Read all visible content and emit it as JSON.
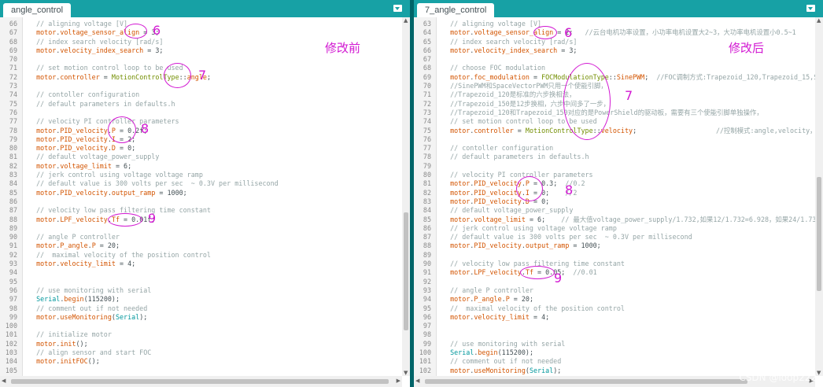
{
  "left": {
    "tab": "angle_control",
    "label": "修改前",
    "lines": [
      [
        66,
        [
          [
            "cm",
            "  // aligning voltage [V]"
          ]
        ]
      ],
      [
        67,
        [
          [
            "obj",
            "  motor"
          ],
          [
            "",
            "."
          ],
          [
            "obj",
            "voltage_sensor_align"
          ],
          [
            "",
            " = 3;"
          ]
        ]
      ],
      [
        68,
        [
          [
            "cm",
            "  // index search velocity [rad/s]"
          ]
        ]
      ],
      [
        69,
        [
          [
            "obj",
            "  motor"
          ],
          [
            "",
            "."
          ],
          [
            "obj",
            "velocity_index_search"
          ],
          [
            "",
            " = 3;"
          ]
        ]
      ],
      [
        70,
        []
      ],
      [
        71,
        [
          [
            "cm",
            "  // set motion control loop to be used"
          ]
        ]
      ],
      [
        72,
        [
          [
            "obj",
            "  motor"
          ],
          [
            "",
            "."
          ],
          [
            "obj",
            "controller"
          ],
          [
            "",
            " = "
          ],
          [
            "ty",
            "MotionControlType"
          ],
          [
            "",
            "::"
          ],
          [
            "obj",
            "angle"
          ],
          [
            "",
            ";"
          ]
        ]
      ],
      [
        73,
        []
      ],
      [
        74,
        [
          [
            "cm",
            "  // contoller configuration"
          ]
        ]
      ],
      [
        75,
        [
          [
            "cm",
            "  // default parameters in defaults.h"
          ]
        ]
      ],
      [
        76,
        []
      ],
      [
        77,
        [
          [
            "cm",
            "  // velocity PI controller parameters"
          ]
        ]
      ],
      [
        78,
        [
          [
            "obj",
            "  motor"
          ],
          [
            "",
            "."
          ],
          [
            "obj",
            "PID_velocity"
          ],
          [
            "",
            "."
          ],
          [
            "obj",
            "P"
          ],
          [
            "",
            " = 0.2f;"
          ]
        ]
      ],
      [
        79,
        [
          [
            "obj",
            "  motor"
          ],
          [
            "",
            "."
          ],
          [
            "obj",
            "PID_velocity"
          ],
          [
            "",
            "."
          ],
          [
            "obj",
            "I"
          ],
          [
            "",
            " = 2;"
          ]
        ]
      ],
      [
        80,
        [
          [
            "obj",
            "  motor"
          ],
          [
            "",
            "."
          ],
          [
            "obj",
            "PID_velocity"
          ],
          [
            "",
            "."
          ],
          [
            "obj",
            "D"
          ],
          [
            "",
            " = 0;"
          ]
        ]
      ],
      [
        81,
        [
          [
            "cm",
            "  // default voltage_power_supply"
          ]
        ]
      ],
      [
        82,
        [
          [
            "obj",
            "  motor"
          ],
          [
            "",
            "."
          ],
          [
            "obj",
            "voltage_limit"
          ],
          [
            "",
            " = 6;"
          ]
        ]
      ],
      [
        83,
        [
          [
            "cm",
            "  // jerk control using voltage voltage ramp"
          ]
        ]
      ],
      [
        84,
        [
          [
            "cm",
            "  // default value is 300 volts per sec  ~ 0.3V per millisecond"
          ]
        ]
      ],
      [
        85,
        [
          [
            "obj",
            "  motor"
          ],
          [
            "",
            "."
          ],
          [
            "obj",
            "PID_velocity"
          ],
          [
            "",
            "."
          ],
          [
            "obj",
            "output_ramp"
          ],
          [
            "",
            " = 1000;"
          ]
        ]
      ],
      [
        86,
        []
      ],
      [
        87,
        [
          [
            "cm",
            "  // velocity low pass filtering time constant"
          ]
        ]
      ],
      [
        88,
        [
          [
            "obj",
            "  motor"
          ],
          [
            "",
            "."
          ],
          [
            "obj",
            "LPF_velocity"
          ],
          [
            "",
            "."
          ],
          [
            "obj",
            "Tf"
          ],
          [
            "",
            " = 0.01f;"
          ]
        ]
      ],
      [
        89,
        []
      ],
      [
        90,
        [
          [
            "cm",
            "  // angle P controller"
          ]
        ]
      ],
      [
        91,
        [
          [
            "obj",
            "  motor"
          ],
          [
            "",
            "."
          ],
          [
            "obj",
            "P_angle"
          ],
          [
            "",
            "."
          ],
          [
            "obj",
            "P"
          ],
          [
            "",
            " = 20;"
          ]
        ]
      ],
      [
        92,
        [
          [
            "cm",
            "  //  maximal velocity of the position control"
          ]
        ]
      ],
      [
        93,
        [
          [
            "obj",
            "  motor"
          ],
          [
            "",
            "."
          ],
          [
            "obj",
            "velocity_limit"
          ],
          [
            "",
            " = 4;"
          ]
        ]
      ],
      [
        94,
        []
      ],
      [
        95,
        []
      ],
      [
        96,
        [
          [
            "cm",
            "  // use monitoring with serial"
          ]
        ]
      ],
      [
        97,
        [
          [
            "kw",
            "  Serial"
          ],
          [
            "",
            "."
          ],
          [
            "obj",
            "begin"
          ],
          [
            "",
            "(115200);"
          ]
        ]
      ],
      [
        98,
        [
          [
            "cm",
            "  // comment out if not needed"
          ]
        ]
      ],
      [
        99,
        [
          [
            "obj",
            "  motor"
          ],
          [
            "",
            "."
          ],
          [
            "obj",
            "useMonitoring"
          ],
          [
            "",
            "("
          ],
          [
            "kw",
            "Serial"
          ],
          [
            "",
            ");"
          ]
        ]
      ],
      [
        100,
        []
      ],
      [
        101,
        [
          [
            "cm",
            "  // initialize motor"
          ]
        ]
      ],
      [
        102,
        [
          [
            "obj",
            "  motor"
          ],
          [
            "",
            "."
          ],
          [
            "obj",
            "init"
          ],
          [
            "",
            "();"
          ]
        ]
      ],
      [
        103,
        [
          [
            "cm",
            "  // align sensor and start FOC"
          ]
        ]
      ],
      [
        104,
        [
          [
            "obj",
            "  motor"
          ],
          [
            "",
            "."
          ],
          [
            "obj",
            "initFOC"
          ],
          [
            "",
            "();"
          ]
        ]
      ],
      [
        105,
        []
      ]
    ],
    "annotations": [
      {
        "text": "6",
        "line": 67
      },
      {
        "text": "7",
        "line": 72
      },
      {
        "text": "8",
        "line": 78
      },
      {
        "text": "9",
        "line": 88
      }
    ]
  },
  "right": {
    "tab": "7_angle_control",
    "label": "修改后",
    "lines": [
      [
        63,
        [
          [
            "cm",
            "  // aligning voltage [V]"
          ]
        ]
      ],
      [
        64,
        [
          [
            "obj",
            "  motor"
          ],
          [
            "",
            "."
          ],
          [
            "obj",
            "voltage_sensor_align"
          ],
          [
            "",
            " = 2;   "
          ],
          [
            "cm",
            "//云台电机功率设置，小功率电机设置大2~3，大功率电机设置小0.5~1"
          ]
        ]
      ],
      [
        65,
        [
          [
            "cm",
            "  // index search velocity [rad/s]"
          ]
        ]
      ],
      [
        66,
        [
          [
            "obj",
            "  motor"
          ],
          [
            "",
            "."
          ],
          [
            "obj",
            "velocity_index_search"
          ],
          [
            "",
            " = 3;"
          ]
        ]
      ],
      [
        67,
        []
      ],
      [
        68,
        [
          [
            "cm",
            "  // choose FOC modulation"
          ]
        ]
      ],
      [
        69,
        [
          [
            "obj",
            "  motor"
          ],
          [
            "",
            "."
          ],
          [
            "obj",
            "foc_modulation"
          ],
          [
            "",
            " = "
          ],
          [
            "ty",
            "FOCModulationType"
          ],
          [
            "",
            "::"
          ],
          [
            "obj",
            "SinePWM"
          ],
          [
            "",
            ";  "
          ],
          [
            "cm",
            "//FOC调制方式:Trapezoid_120,Trapezoid_15,SinePWM,Sp"
          ]
        ]
      ],
      [
        70,
        [
          [
            "cm",
            "  //SinePWM和SpaceVectorPWM只用一个使能引脚，"
          ]
        ]
      ],
      [
        71,
        [
          [
            "cm",
            "  //Trapezoid_120是标准的六步换相法，"
          ]
        ]
      ],
      [
        72,
        [
          [
            "cm",
            "  //Trapezoid_150是12步换相，六步中间多了一步，"
          ]
        ]
      ],
      [
        73,
        [
          [
            "cm",
            "  //Trapezoid_120和Trapezoid_150对应的是PowerShield的驱动板，需要有三个使能引脚单独操作，"
          ]
        ]
      ],
      [
        74,
        [
          [
            "cm",
            "  // set motion control loop to be used"
          ]
        ]
      ],
      [
        75,
        [
          [
            "obj",
            "  motor"
          ],
          [
            "",
            "."
          ],
          [
            "obj",
            "controller"
          ],
          [
            "",
            " = "
          ],
          [
            "ty",
            "MotionControlType"
          ],
          [
            "",
            "::"
          ],
          [
            "obj",
            "velocity"
          ],
          [
            "",
            ";                    "
          ],
          [
            "cm",
            "//控制模式:angle,velocity，最好不要用hall电机做"
          ]
        ]
      ],
      [
        76,
        []
      ],
      [
        77,
        [
          [
            "cm",
            "  // contoller configuration"
          ]
        ]
      ],
      [
        78,
        [
          [
            "cm",
            "  // default parameters in defaults.h"
          ]
        ]
      ],
      [
        79,
        []
      ],
      [
        80,
        [
          [
            "cm",
            "  // velocity PI controller parameters"
          ]
        ]
      ],
      [
        81,
        [
          [
            "obj",
            "  motor"
          ],
          [
            "",
            "."
          ],
          [
            "obj",
            "PID_velocity"
          ],
          [
            "",
            "."
          ],
          [
            "obj",
            "P"
          ],
          [
            "",
            " = 0.3;  "
          ],
          [
            "cm",
            "//0.2"
          ]
        ]
      ],
      [
        82,
        [
          [
            "obj",
            "  motor"
          ],
          [
            "",
            "."
          ],
          [
            "obj",
            "PID_velocity"
          ],
          [
            "",
            "."
          ],
          [
            "obj",
            "I"
          ],
          [
            "",
            " = 0;    "
          ],
          [
            "cm",
            "//2"
          ]
        ]
      ],
      [
        83,
        [
          [
            "obj",
            "  motor"
          ],
          [
            "",
            "."
          ],
          [
            "obj",
            "PID_velocity"
          ],
          [
            "",
            "."
          ],
          [
            "obj",
            "D"
          ],
          [
            "",
            " = 0;"
          ]
        ]
      ],
      [
        84,
        [
          [
            "cm",
            "  // default voltage_power_supply"
          ]
        ]
      ],
      [
        85,
        [
          [
            "obj",
            "  motor"
          ],
          [
            "",
            "."
          ],
          [
            "obj",
            "voltage_limit"
          ],
          [
            "",
            " = 6;    "
          ],
          [
            "cm",
            "// 最大值voltage_power_supply/1.732,如果12/1.732=6.928，如果24/1.732=13.856"
          ]
        ]
      ],
      [
        86,
        [
          [
            "cm",
            "  // jerk control using voltage voltage ramp"
          ]
        ]
      ],
      [
        87,
        [
          [
            "cm",
            "  // default value is 300 volts per sec  ~ 0.3V per millisecond"
          ]
        ]
      ],
      [
        88,
        [
          [
            "obj",
            "  motor"
          ],
          [
            "",
            "."
          ],
          [
            "obj",
            "PID_velocity"
          ],
          [
            "",
            "."
          ],
          [
            "obj",
            "output_ramp"
          ],
          [
            "",
            " = 1000;"
          ]
        ]
      ],
      [
        89,
        []
      ],
      [
        90,
        [
          [
            "cm",
            "  // velocity low pass filtering time constant"
          ]
        ]
      ],
      [
        91,
        [
          [
            "obj",
            "  motor"
          ],
          [
            "",
            "."
          ],
          [
            "obj",
            "LPF_velocity"
          ],
          [
            "",
            "."
          ],
          [
            "obj",
            "Tf"
          ],
          [
            "",
            " = 0.05;  "
          ],
          [
            "cm",
            "//0.01"
          ]
        ]
      ],
      [
        92,
        []
      ],
      [
        93,
        [
          [
            "cm",
            "  // angle P controller"
          ]
        ]
      ],
      [
        94,
        [
          [
            "obj",
            "  motor"
          ],
          [
            "",
            "."
          ],
          [
            "obj",
            "P_angle"
          ],
          [
            "",
            "."
          ],
          [
            "obj",
            "P"
          ],
          [
            "",
            " = 20;"
          ]
        ]
      ],
      [
        95,
        [
          [
            "cm",
            "  //  maximal velocity of the position control"
          ]
        ]
      ],
      [
        96,
        [
          [
            "obj",
            "  motor"
          ],
          [
            "",
            "."
          ],
          [
            "obj",
            "velocity_limit"
          ],
          [
            "",
            " = 4;"
          ]
        ]
      ],
      [
        97,
        []
      ],
      [
        98,
        []
      ],
      [
        99,
        [
          [
            "cm",
            "  // use monitoring with serial"
          ]
        ]
      ],
      [
        100,
        [
          [
            "kw",
            "  Serial"
          ],
          [
            "",
            "."
          ],
          [
            "obj",
            "begin"
          ],
          [
            "",
            "(115200);"
          ]
        ]
      ],
      [
        101,
        [
          [
            "cm",
            "  // comment out if not needed"
          ]
        ]
      ],
      [
        102,
        [
          [
            "obj",
            "  motor"
          ],
          [
            "",
            "."
          ],
          [
            "obj",
            "useMonitoring"
          ],
          [
            "",
            "("
          ],
          [
            "kw",
            "Serial"
          ],
          [
            "",
            ");"
          ]
        ]
      ]
    ],
    "annotations": [
      {
        "text": "6",
        "line": 64
      },
      {
        "text": "7",
        "line": 73
      },
      {
        "text": "8",
        "line": 82
      },
      {
        "text": "9",
        "line": 92
      }
    ]
  },
  "watermark": "CSDN @loop222"
}
